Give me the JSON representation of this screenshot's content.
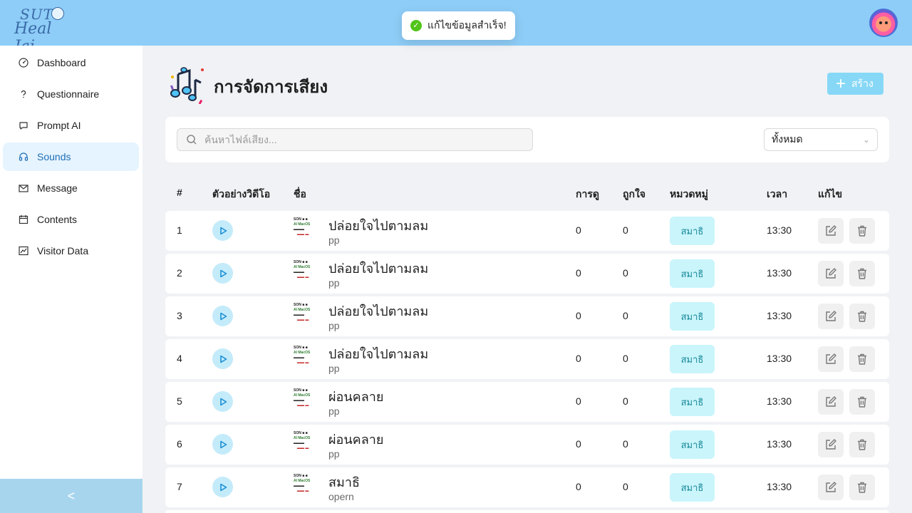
{
  "brand": {
    "line1": "SUT",
    "line2": "Heal Jai"
  },
  "toast": {
    "message": "แก้ไขข้อมูลสำเร็จ!"
  },
  "sidebar": {
    "items": [
      {
        "label": "Dashboard",
        "icon": "dashboard-icon"
      },
      {
        "label": "Questionnaire",
        "icon": "question-icon"
      },
      {
        "label": "Prompt AI",
        "icon": "chat-icon"
      },
      {
        "label": "Sounds",
        "icon": "headphones-icon",
        "active": true
      },
      {
        "label": "Message",
        "icon": "mail-icon"
      },
      {
        "label": "Contents",
        "icon": "calendar-icon"
      },
      {
        "label": "Visitor Data",
        "icon": "line-chart-icon"
      }
    ],
    "collapse_label": "<"
  },
  "page": {
    "title": "การจัดการเสียง",
    "create_label": "สร้าง"
  },
  "filters": {
    "search_placeholder": "ค้นหาไฟล์เสียง...",
    "category_value": "ทั้งหมด"
  },
  "table": {
    "headers": {
      "index": "#",
      "preview": "ตัวอย่างวิดีโอ",
      "name": "ชื่อ",
      "views": "การดู",
      "likes": "ถูกใจ",
      "category": "หมวดหมู่",
      "time": "เวลา",
      "edit": "แก้ไข"
    },
    "rows": [
      {
        "index": "1",
        "name": "ปล่อยใจไปตามลม",
        "sub": "pp",
        "views": "0",
        "likes": "0",
        "category": "สมาธิ",
        "time": "13:30"
      },
      {
        "index": "2",
        "name": "ปล่อยใจไปตามลม",
        "sub": "pp",
        "views": "0",
        "likes": "0",
        "category": "สมาธิ",
        "time": "13:30"
      },
      {
        "index": "3",
        "name": "ปล่อยใจไปตามลม",
        "sub": "pp",
        "views": "0",
        "likes": "0",
        "category": "สมาธิ",
        "time": "13:30"
      },
      {
        "index": "4",
        "name": "ปล่อยใจไปตามลม",
        "sub": "pp",
        "views": "0",
        "likes": "0",
        "category": "สมาธิ",
        "time": "13:30"
      },
      {
        "index": "5",
        "name": "ผ่อนคลาย",
        "sub": "pp",
        "views": "0",
        "likes": "0",
        "category": "สมาธิ",
        "time": "13:30"
      },
      {
        "index": "6",
        "name": "ผ่อนคลาย",
        "sub": "pp",
        "views": "0",
        "likes": "0",
        "category": "สมาธิ",
        "time": "13:30"
      },
      {
        "index": "7",
        "name": "สมาธิ",
        "sub": "opern",
        "views": "0",
        "likes": "0",
        "category": "สมาธิ",
        "time": "13:30"
      }
    ]
  },
  "colors": {
    "topbar": "#8ecdf7",
    "active_nav_bg": "#e6f4ff",
    "tag_bg": "#c9f5fb",
    "success": "#52c41a"
  }
}
